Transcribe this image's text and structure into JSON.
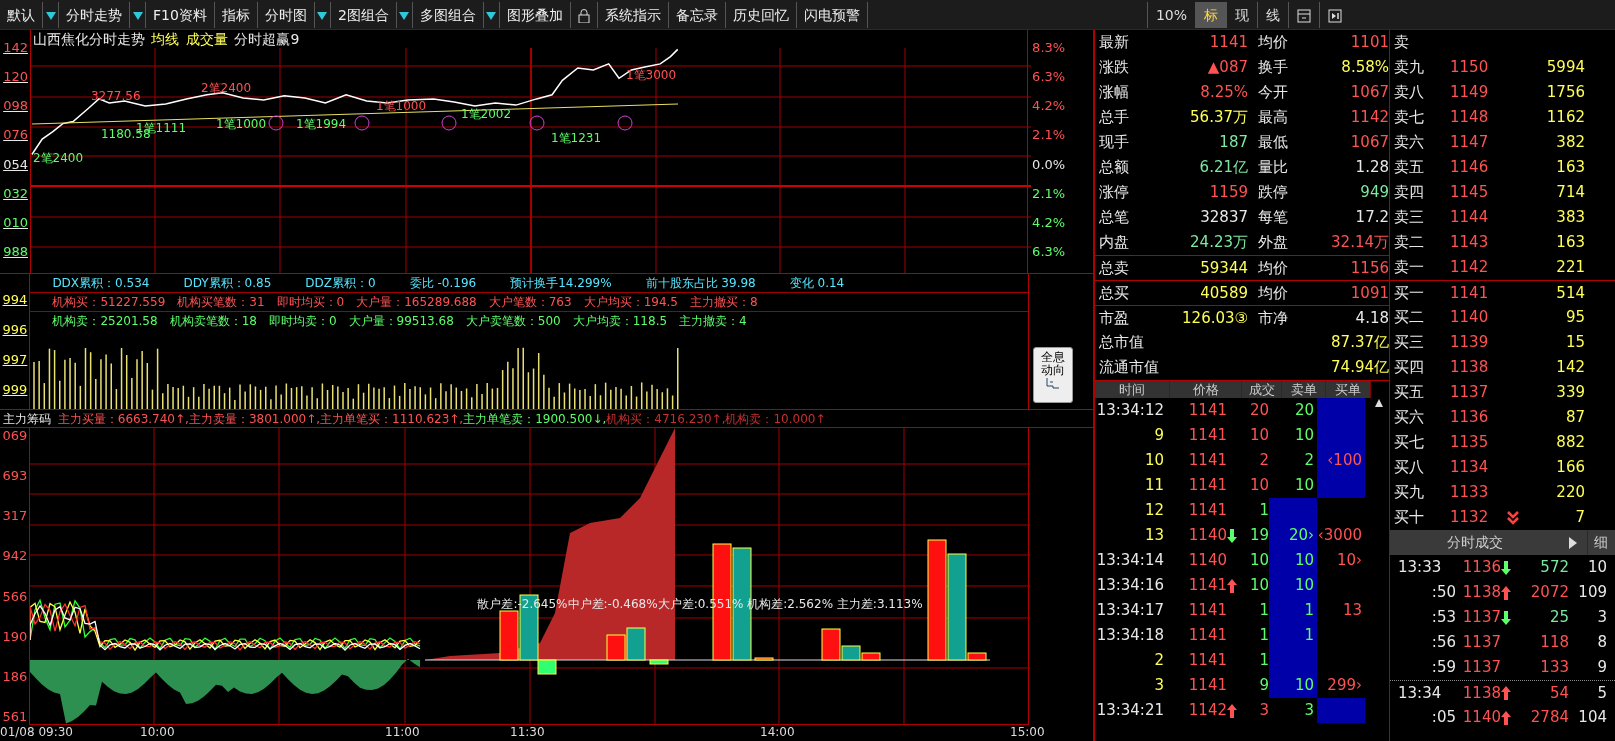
{
  "toolbar": {
    "items": [
      {
        "kind": "menu",
        "label": "默认"
      },
      {
        "kind": "menu",
        "label": "分时走势"
      },
      {
        "kind": "button",
        "label": "F10资料"
      },
      {
        "kind": "button",
        "label": "指标"
      },
      {
        "kind": "menu",
        "label": "分时图"
      },
      {
        "kind": "menu",
        "label": "2图组合"
      },
      {
        "kind": "menu",
        "label": "多图组合"
      },
      {
        "kind": "button",
        "label": "图形叠加"
      },
      {
        "kind": "lock"
      },
      {
        "kind": "button",
        "label": "系统指示"
      },
      {
        "kind": "button",
        "label": "备忘录"
      },
      {
        "kind": "button",
        "label": "历史回忆"
      },
      {
        "kind": "button",
        "label": "闪电预警"
      }
    ],
    "view_tabs": [
      {
        "label": "10%",
        "selected": false
      },
      {
        "label": "标",
        "selected": true
      },
      {
        "label": "现",
        "selected": false
      },
      {
        "label": "线",
        "selected": false
      }
    ]
  },
  "price_chart": {
    "title": [
      {
        "text": "山西焦化分时走势",
        "color": "#e8e8e8"
      },
      {
        "text": "均线",
        "color": "#ffff55"
      },
      {
        "text": "成交量",
        "color": "#ffff55"
      },
      {
        "text": "分时超赢9",
        "color": "#e8e8e8"
      }
    ],
    "left_axis": [
      {
        "text": "142",
        "color": "#ff5252"
      },
      {
        "text": "120",
        "color": "#ff5252"
      },
      {
        "text": "098",
        "color": "#ff5252"
      },
      {
        "text": "076",
        "color": "#ff5252"
      },
      {
        "text": "054",
        "color": "#e8e8e8"
      },
      {
        "text": "032",
        "color": "#5cff6a"
      },
      {
        "text": "010",
        "color": "#5cff6a"
      },
      {
        "text": "988",
        "color": "#5cff6a"
      }
    ],
    "right_axis": [
      {
        "text": "8.3%",
        "color": "#ff5252"
      },
      {
        "text": "6.3%",
        "color": "#ff5252"
      },
      {
        "text": "4.2%",
        "color": "#ff5252"
      },
      {
        "text": "2.1%",
        "color": "#ff5252"
      },
      {
        "text": "0.0%",
        "color": "#e8e8e8"
      },
      {
        "text": "2.1%",
        "color": "#5cff6a"
      },
      {
        "text": "4.2%",
        "color": "#5cff6a"
      },
      {
        "text": "6.3%",
        "color": "#5cff6a"
      }
    ],
    "annotations": [
      {
        "text": "3277.56",
        "color": "#ff5252"
      },
      {
        "text": "2笔2400",
        "color": "#ff5252"
      },
      {
        "text": "1笔1000",
        "color": "#ff5252"
      },
      {
        "text": "1笔3000",
        "color": "#ff5252"
      },
      {
        "text": "1180.58",
        "color": "#5cff6a"
      },
      {
        "text": "1笔1111",
        "color": "#5cff6a"
      },
      {
        "text": "1笔1000",
        "color": "#5cff6a"
      },
      {
        "text": "1笔1994",
        "color": "#5cff6a"
      },
      {
        "text": "1笔2002",
        "color": "#5cff6a"
      },
      {
        "text": "1笔1231",
        "color": "#5cff6a"
      },
      {
        "text": "2笔2400",
        "color": "#5cff6a"
      }
    ]
  },
  "indicator": {
    "stats_line": [
      "DDX累积：0.534",
      "DDY累积：0.85",
      "DDZ累积：0",
      "委比 -0.196",
      "预计换手14.299%",
      "前十股东占比 39.98",
      "变化 0.14"
    ],
    "buy_line": [
      "机构买：51227.559",
      "机构买笔数：31",
      "即时均买：0",
      "大户量：165289.688",
      "大户笔数：763",
      "大户均买：194.5",
      "主力撤买：8"
    ],
    "sell_line": [
      "机构卖：25201.58",
      "机构卖笔数：18",
      "即时均卖：0",
      "大户量：99513.68",
      "大户卖笔数：500",
      "大户均卖：118.5",
      "主力撤卖：4"
    ],
    "volume_axis": [
      "994",
      "996",
      "997",
      "999"
    ],
    "panorama_button": "全息动向"
  },
  "chip_chart": {
    "title": "主力筹码",
    "metrics": [
      {
        "text": "主力买量：6663.740↑,",
        "color": "#ff5252"
      },
      {
        "text": "主力卖量：3801.000↑,",
        "color": "#ff5252"
      },
      {
        "text": "主力单笔买：1110.623↑,",
        "color": "#ff5252"
      },
      {
        "text": "主力单笔卖：1900.500↓,",
        "color": "#5cff6a"
      },
      {
        "text": "机构买：4716.230↑,",
        "color": "#c43030"
      },
      {
        "text": "机构卖：10.000↑",
        "color": "#c43030"
      }
    ],
    "left_axis": [
      "069",
      "693",
      "317",
      "942",
      "566",
      "190",
      "186",
      "561"
    ],
    "overlay": "散户差:-2.645%中户差:-0.468%大户差:0.551% 机构差:2.562% 主力差:3.113%",
    "time_axis": [
      "01/08 09:30",
      "10:00",
      "11:00",
      "11:30",
      "14:00",
      "15:00"
    ]
  },
  "quote": [
    {
      "boxed": false,
      "cells": [
        {
          "label": "最新",
          "value": "1141",
          "color": "#ff5252"
        },
        {
          "label": "均价",
          "value": "1101",
          "color": "#ff5252"
        }
      ]
    },
    {
      "boxed": false,
      "cells": [
        {
          "label": "涨跌",
          "value": "▲087",
          "color": "#ff5252"
        },
        {
          "label": "换手",
          "value": "8.58%",
          "color": "#ffff55"
        }
      ]
    },
    {
      "boxed": false,
      "cells": [
        {
          "label": "涨幅",
          "value": "8.25%",
          "color": "#ff5252"
        },
        {
          "label": "今开",
          "value": "1067",
          "color": "#ff5252"
        }
      ]
    },
    {
      "boxed": false,
      "cells": [
        {
          "label": "总手",
          "value": "56.37万",
          "color": "#ffff55"
        },
        {
          "label": "最高",
          "value": "1142",
          "color": "#ff5252"
        }
      ]
    },
    {
      "boxed": false,
      "cells": [
        {
          "label": "现手",
          "value": "187",
          "color": "#7ce8a0"
        },
        {
          "label": "最低",
          "value": "1067",
          "color": "#ff5252"
        }
      ]
    },
    {
      "boxed": false,
      "cells": [
        {
          "label": "总额",
          "value": "6.21亿",
          "color": "#7ce8a0"
        },
        {
          "label": "量比",
          "value": "1.28",
          "color": "#e8e8e8"
        }
      ]
    },
    {
      "boxed": false,
      "cells": [
        {
          "label": "涨停",
          "value": "1159",
          "color": "#ff5252"
        },
        {
          "label": "跌停",
          "value": "949",
          "color": "#7ce8a0"
        }
      ]
    },
    {
      "boxed": false,
      "cells": [
        {
          "label": "总笔",
          "value": "32837",
          "color": "#e8e8e8"
        },
        {
          "label": "每笔",
          "value": "17.2",
          "color": "#e8e8e8"
        }
      ]
    },
    {
      "boxed": false,
      "cells": [
        {
          "label": "内盘",
          "value": "24.23万",
          "color": "#7ce8a0"
        },
        {
          "label": "外盘",
          "value": "32.14万",
          "color": "#ff5252"
        }
      ]
    },
    {
      "boxed": true,
      "cells": [
        {
          "label": "总卖",
          "value": "59344",
          "color": "#ffff55"
        },
        {
          "label": "均价",
          "value": "1156",
          "color": "#ff5252"
        }
      ]
    },
    {
      "boxed": true,
      "cells": [
        {
          "label": "总买",
          "value": "40589",
          "color": "#ffff55"
        },
        {
          "label": "均价",
          "value": "1091",
          "color": "#ff5252"
        }
      ]
    },
    {
      "boxed": true,
      "cells": [
        {
          "label": "市盈",
          "value": "126.03③",
          "color": "#ffff55"
        },
        {
          "label": "市净",
          "value": "4.18",
          "color": "#e8e8e8"
        }
      ]
    },
    {
      "boxed": false,
      "cells": [
        {
          "label": "总市值",
          "value": "87.37亿",
          "color": "#ffff55"
        }
      ]
    },
    {
      "boxed": false,
      "cells": [
        {
          "label": "流通市值",
          "value": "74.94亿",
          "color": "#ffff55"
        }
      ]
    }
  ],
  "order_book": [
    {
      "label": "卖",
      "marker": false
    },
    {
      "label": "卖九",
      "price": "1150",
      "volume": "5994",
      "marker": false
    },
    {
      "label": "卖八",
      "price": "1149",
      "volume": "1756",
      "marker": false
    },
    {
      "label": "卖七",
      "price": "1148",
      "volume": "1162",
      "marker": false
    },
    {
      "label": "卖六",
      "price": "1147",
      "volume": "382",
      "marker": false
    },
    {
      "label": "卖五",
      "price": "1146",
      "volume": "163",
      "marker": false
    },
    {
      "label": "卖四",
      "price": "1145",
      "volume": "714",
      "marker": false
    },
    {
      "label": "卖三",
      "price": "1144",
      "volume": "383",
      "marker": false
    },
    {
      "label": "卖二",
      "price": "1143",
      "volume": "163",
      "marker": false
    },
    {
      "label": "卖一",
      "price": "1142",
      "volume": "221",
      "marker": false
    },
    {
      "label": "买一",
      "price": "1141",
      "volume": "514",
      "marker": false
    },
    {
      "label": "买二",
      "price": "1140",
      "volume": "95",
      "marker": false
    },
    {
      "label": "买三",
      "price": "1139",
      "volume": "15",
      "marker": false
    },
    {
      "label": "买四",
      "price": "1138",
      "volume": "142",
      "marker": false
    },
    {
      "label": "买五",
      "price": "1137",
      "volume": "339",
      "marker": false
    },
    {
      "label": "买六",
      "price": "1136",
      "volume": "87",
      "marker": false
    },
    {
      "label": "买七",
      "price": "1135",
      "volume": "882",
      "marker": false
    },
    {
      "label": "买八",
      "price": "1134",
      "volume": "166",
      "marker": false
    },
    {
      "label": "买九",
      "price": "1133",
      "volume": "220",
      "marker": false
    },
    {
      "label": "买十",
      "price": "1132",
      "volume": "7",
      "marker": true
    }
  ],
  "trades": {
    "columns": [
      "时间",
      "价格",
      "成交",
      "卖单",
      "买单"
    ],
    "rows": [
      {
        "time": "13:34:12",
        "kind": "full",
        "price": "1141",
        "rising": false,
        "falling": false,
        "volume": "20",
        "color": "#ff5252",
        "sell": "20",
        "sell_fill": false,
        "buy_fill": true
      },
      {
        "time": "9",
        "kind": "short",
        "price": "1141",
        "rising": false,
        "falling": false,
        "volume": "10",
        "color": "#ff5252",
        "sell": "10",
        "sell_fill": false,
        "buy_fill": true
      },
      {
        "time": "10",
        "kind": "short",
        "price": "1141",
        "rising": false,
        "falling": false,
        "volume": "2",
        "color": "#ff5252",
        "sell": "2",
        "sell_fill": false,
        "buy_fill": true,
        "buy": "‹100"
      },
      {
        "time": "11",
        "kind": "short",
        "price": "1141",
        "rising": false,
        "falling": false,
        "volume": "10",
        "color": "#ff5252",
        "sell": "10",
        "sell_fill": false,
        "buy_fill": true
      },
      {
        "time": "12",
        "kind": "short",
        "price": "1141",
        "rising": false,
        "falling": false,
        "volume": "1",
        "color": "#5cff6a",
        "sell_fill": true,
        "buy_fill": false
      },
      {
        "time": "13",
        "kind": "short",
        "price": "1140",
        "rising": false,
        "falling": true,
        "volume": "19",
        "color": "#5cff6a",
        "sell": "20›",
        "sell_fill": true,
        "buy_fill": false,
        "buy": "‹3000"
      },
      {
        "time": "13:34:14",
        "kind": "full",
        "price": "1140",
        "rising": false,
        "falling": false,
        "volume": "10",
        "color": "#5cff6a",
        "sell": "10",
        "sell_fill": true,
        "buy_fill": false,
        "buy": "10›"
      },
      {
        "time": "13:34:16",
        "kind": "full",
        "price": "1141",
        "rising": true,
        "falling": false,
        "volume": "10",
        "color": "#5cff6a",
        "sell": "10",
        "sell_fill": true,
        "buy_fill": false
      },
      {
        "time": "13:34:17",
        "kind": "full",
        "price": "1141",
        "rising": false,
        "falling": false,
        "volume": "1",
        "color": "#5cff6a",
        "sell": "1",
        "sell_fill": true,
        "buy_fill": false,
        "buy": "13"
      },
      {
        "time": "13:34:18",
        "kind": "full",
        "price": "1141",
        "rising": false,
        "falling": false,
        "volume": "1",
        "color": "#5cff6a",
        "sell": "1",
        "sell_fill": true,
        "buy_fill": false
      },
      {
        "time": "2",
        "kind": "short",
        "price": "1141",
        "rising": false,
        "falling": false,
        "volume": "1",
        "color": "#5cff6a",
        "sell_fill": true,
        "buy_fill": false
      },
      {
        "time": "3",
        "kind": "short",
        "price": "1141",
        "rising": false,
        "falling": false,
        "volume": "9",
        "color": "#5cff6a",
        "sell": "10",
        "sell_fill": true,
        "buy_fill": false,
        "buy": "299›"
      },
      {
        "time": "13:34:21",
        "kind": "full",
        "price": "1142",
        "rising": true,
        "falling": false,
        "volume": "3",
        "color": "#ff5252",
        "sell": "3",
        "sell_fill": false,
        "buy_fill": true
      }
    ]
  },
  "tick_panel": {
    "title": "分时成交",
    "detail": "细",
    "rows": [
      {
        "time": "13:33",
        "price": "1136",
        "rising": false,
        "falling": true,
        "volume": "572",
        "color": "#7ce8a0",
        "count": "10"
      },
      {
        "time": ":50",
        "price": "1138",
        "rising": true,
        "falling": false,
        "volume": "2072",
        "color": "#ff5252",
        "count": "109"
      },
      {
        "time": ":53",
        "price": "1137",
        "rising": false,
        "falling": true,
        "volume": "25",
        "color": "#7ce8a0",
        "count": "3"
      },
      {
        "time": ":56",
        "price": "1137",
        "rising": false,
        "falling": false,
        "volume": "118",
        "color": "#ff5252",
        "count": "8"
      },
      {
        "time": ":59",
        "price": "1137",
        "rising": false,
        "falling": false,
        "volume": "133",
        "color": "#ff5252",
        "count": "9"
      },
      {
        "time": "13:34",
        "price": "1138",
        "rising": true,
        "falling": false,
        "volume": "54",
        "color": "#ff5252",
        "count": "5"
      },
      {
        "time": ":05",
        "price": "1140",
        "rising": true,
        "falling": false,
        "volume": "2784",
        "color": "#ff5252",
        "count": "104"
      }
    ]
  }
}
